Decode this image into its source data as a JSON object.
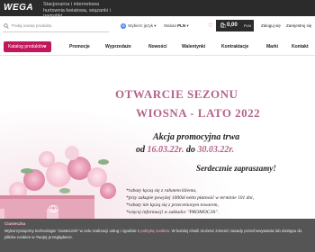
{
  "brand": {
    "logo": "WEGA",
    "tagline": "Stacjonarna i internetowa hurtownia kwiatowa, wiązanki i nagrobki"
  },
  "header": {
    "search_placeholder": "Podaj nazwę produktu",
    "language_label": "Wybierz język",
    "currency_label": "Waluta",
    "currency_value": "PLN",
    "cart_amount": "0,00",
    "cart_currency": "PLN",
    "login": "Zaloguj się",
    "register": "Zarejestruj się"
  },
  "nav": {
    "categories_button": "Katalog produktów",
    "items": [
      "Promocje",
      "Wyprzedaże",
      "Nowości",
      "Walentynki",
      "Kontraktacje",
      "Marki",
      "Kontakt"
    ]
  },
  "banner": {
    "title_line1": "OTWARCIE SEZONU",
    "title_line2": "WIOSNA - LATO 2022",
    "promo_line1": "Akcja promocyjna trwa",
    "promo_from": "od",
    "promo_date_from": "16.03.22r.",
    "promo_to": "do",
    "promo_date_to": "30.03.22r.",
    "welcome": "Serdecznie zapraszamy!",
    "notes": [
      "*rabaty łączą się z rabatem klienta,",
      "*przy zakupie powyżej 1000zł netto płatność w terminie 101 dni,",
      "*rabaty nie łączą się z przecenionym towarem,",
      "*więcej informacji w zakładce \"PROMOCJA\"."
    ]
  },
  "cookie": {
    "title": "Ciasteczka",
    "text_before": "Wykorzystujemy technologie \"ciasteczek\" w celu realizacji usług i zgodnie z",
    "link": "polityką cookies",
    "text_after": ". W każdej chwili możesz zmienić zasady przechowywania lub dostępu do plików cookies w Twojej przeglądarce."
  },
  "colors": {
    "accent": "#c2185b",
    "topbar": "#2b2b2b",
    "banner_title": "#b4638a"
  }
}
